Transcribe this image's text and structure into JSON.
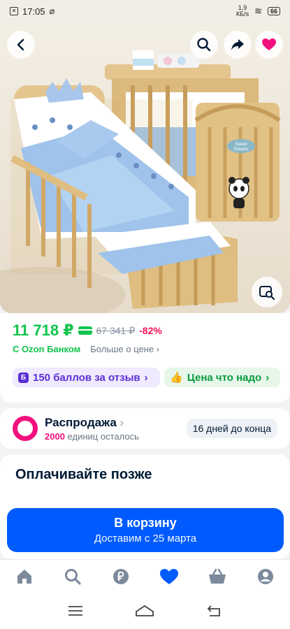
{
  "status_bar": {
    "time": "17:05",
    "net_speed_value": "1,9",
    "net_speed_unit": "КБ/s",
    "battery": "66"
  },
  "hero": {
    "image_name": "product-photo-baby-crib",
    "decal_text_1": "Sweet",
    "decal_text_2": "Dreams"
  },
  "price": {
    "current": "11 718 ₽",
    "old": "67 341 ₽",
    "discount": "-82%",
    "bank_label": "С Ozon Банком",
    "more_label": "Больше о цене",
    "colors": {
      "green": "#10c44c",
      "red": "#f91155"
    }
  },
  "chips": {
    "points_badge": "Б",
    "points_label": "150 баллов за отзыв",
    "fair_price_label": "Цена что надо"
  },
  "sale": {
    "title": "Распродажа",
    "count": "2000",
    "count_suffix": "единиц осталось",
    "days_left": "16 дней до конца",
    "accent": "#f1117e"
  },
  "pay_later": {
    "title": "Оплачивайте позже"
  },
  "cart": {
    "title": "В корзину",
    "subtitle": "Доставим с 25 марта",
    "color": "#005bff"
  },
  "bottom_nav": {
    "items": [
      "home-icon",
      "search-icon",
      "ruble-icon",
      "heart-icon",
      "basket-icon",
      "profile-icon"
    ],
    "active": "heart-icon"
  }
}
